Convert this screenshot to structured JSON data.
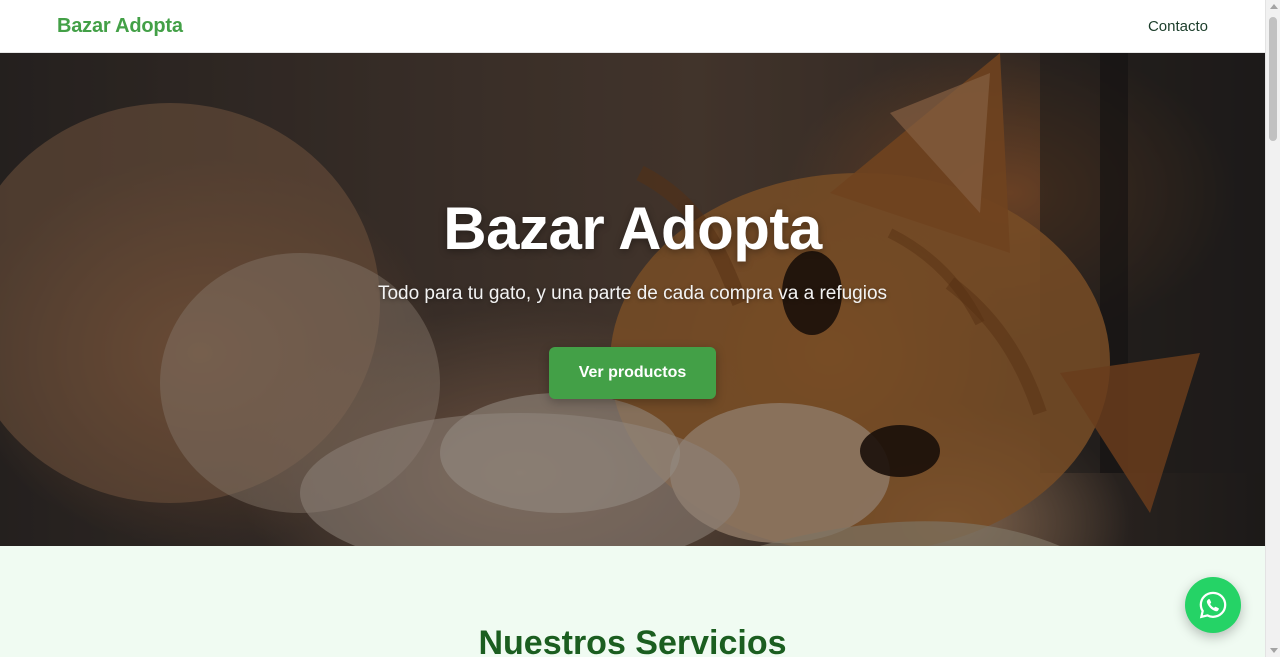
{
  "header": {
    "brand": "Bazar Adopta",
    "nav": {
      "contact_label": "Contacto"
    }
  },
  "hero": {
    "title": "Bazar Adopta",
    "subtitle": "Todo para tu gato, y una parte de cada compra va a refugios",
    "cta_label": "Ver productos",
    "background_image": "orange-tabby-cat-photo"
  },
  "services": {
    "title": "Nuestros Servicios"
  },
  "floating": {
    "whatsapp_icon": "whatsapp-icon"
  },
  "colors": {
    "brand_green": "#43a047",
    "dark_green": "#1b5e20",
    "whatsapp_green": "#25d366",
    "services_bg": "#f0fbf2"
  }
}
